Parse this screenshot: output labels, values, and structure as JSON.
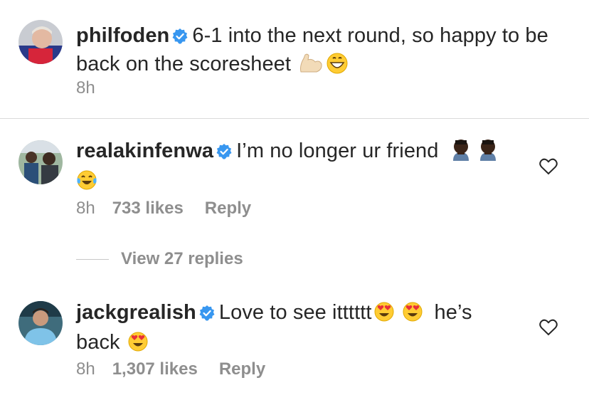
{
  "caption": {
    "username": "philfoden",
    "text": "6-1 into the next round, so happy to be back on the scoresheet",
    "emojis": [
      "flexed-biceps",
      "grinning-face"
    ],
    "time": "8h"
  },
  "comments": [
    {
      "username": "realakinfenwa",
      "text": "I’m no longer ur friend",
      "emojis_inline": [
        "man-facepalming",
        "man-facepalming"
      ],
      "emojis_next_line": [
        "face-with-tears-of-joy"
      ],
      "time": "8h",
      "likes": "733 likes",
      "reply": "Reply",
      "view_replies": "View 27 replies"
    },
    {
      "username": "jackgrealish",
      "text": "Love to see itttttt",
      "text_after": "he’s",
      "text_line2": "back",
      "emojis_inline": [
        "heart-eyes",
        "heart-eyes"
      ],
      "emojis_next_line": [
        "heart-eyes"
      ],
      "time": "8h",
      "likes": "1,307 likes",
      "reply": "Reply"
    }
  ],
  "colors": {
    "text": "#262626",
    "secondary": "#8e8e8e",
    "verified": "#3897f0",
    "divider": "#dbdbdb"
  }
}
